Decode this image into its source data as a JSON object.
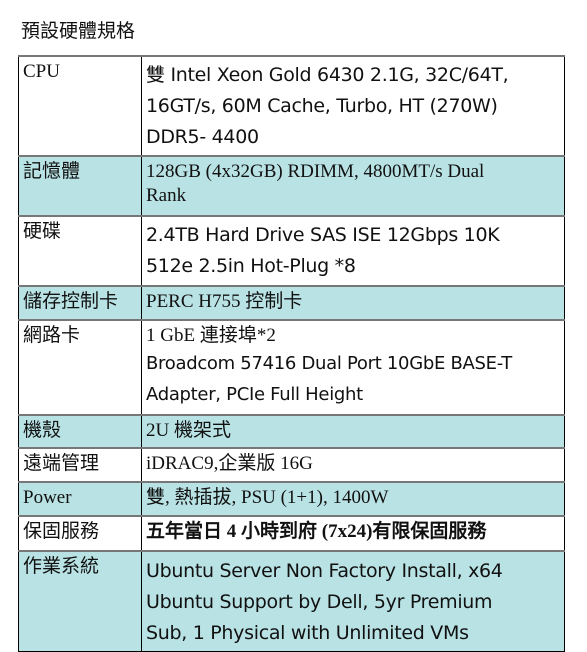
{
  "title": "預設硬體規格",
  "rows": [
    {
      "label": "CPU",
      "lines": [
        "雙 Intel Xeon Gold 6430 2.1G, 32C/64T,",
        "16GT/s, 60M Cache, Turbo, HT (270W)",
        "DDR5- 4400"
      ]
    },
    {
      "label": "記憶體",
      "lines": [
        "128GB (4x32GB) RDIMM, 4800MT/s Dual",
        "Rank"
      ]
    },
    {
      "label": "硬碟",
      "lines": [
        "2.4TB Hard Drive SAS ISE 12Gbps 10K",
        "512e 2.5in Hot-Plug *8"
      ]
    },
    {
      "label": "儲存控制卡",
      "lines": [
        "PERC H755 控制卡"
      ]
    },
    {
      "label": "網路卡",
      "lines": [
        "1 GbE 連接埠*2",
        "Broadcom 57416 Dual Port 10GbE BASE-T",
        "Adapter, PCIe Full Height"
      ]
    },
    {
      "label": "機殼",
      "lines": [
        "2U 機架式"
      ]
    },
    {
      "label": "遠端管理",
      "lines": [
        "iDRAC9,企業版 16G"
      ]
    },
    {
      "label": "Power",
      "lines": [
        "雙, 熱插拔, PSU (1+1), 1400W"
      ]
    },
    {
      "label": "保固服務",
      "lines": [
        "五年當日 4 小時到府 (7x24)有限保固服務"
      ]
    },
    {
      "label": "作業系統",
      "lines": [
        "Ubuntu Server Non Factory Install, x64",
        "Ubuntu Support by Dell, 5yr Premium",
        "Sub, 1 Physical with Unlimited VMs"
      ]
    }
  ],
  "colors": {
    "shade": "#b9e2e4",
    "plain": "#ffffff",
    "border": "#000000"
  }
}
